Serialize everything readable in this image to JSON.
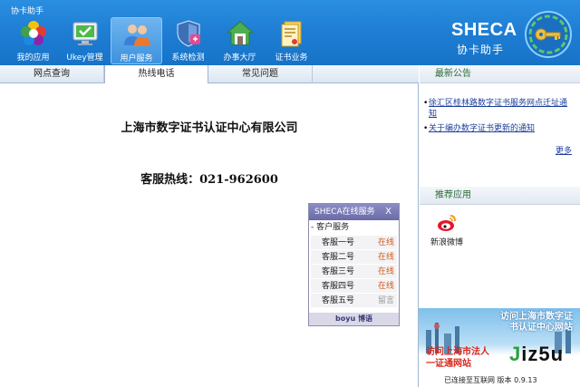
{
  "app": {
    "title": "协卡助手"
  },
  "toolbar": [
    {
      "label": "我的应用",
      "icon": "my-apps-icon",
      "active": false
    },
    {
      "label": "Ukey管理",
      "icon": "ukey-monitor-icon",
      "active": false
    },
    {
      "label": "用户服务",
      "icon": "user-service-icon",
      "active": true
    },
    {
      "label": "系统检测",
      "icon": "system-check-icon",
      "active": false
    },
    {
      "label": "办事大厅",
      "icon": "service-hall-icon",
      "active": false
    },
    {
      "label": "证书业务",
      "icon": "certificate-business-icon",
      "active": false
    }
  ],
  "brand": {
    "name": "SHECA",
    "subtitle": "协卡助手",
    "icon": "sheca-key-logo-icon"
  },
  "tabs": [
    {
      "label": "网点查询",
      "active": false
    },
    {
      "label": "热线电话",
      "active": true
    },
    {
      "label": "常见问题",
      "active": false
    }
  ],
  "main": {
    "company": "上海市数字证书认证中心有限公司",
    "hotline": "客服热线：021-962600"
  },
  "service_widget": {
    "title": "SHECA在线服务",
    "close": "X",
    "group": "客户服务",
    "group_prefix": "-",
    "agents": [
      {
        "name": "客服一号",
        "status": "在线"
      },
      {
        "name": "客服二号",
        "status": "在线"
      },
      {
        "name": "客服三号",
        "status": "在线"
      },
      {
        "name": "客服四号",
        "status": "在线"
      },
      {
        "name": "客服五号",
        "status": "留言"
      }
    ],
    "footer": "boyu 博语"
  },
  "sidebar": {
    "news_title": "最新公告",
    "news": [
      {
        "text": "徐汇区桂林路数字证书服务网点迁址通知"
      },
      {
        "text": "关于编办数字证书更新的通知"
      }
    ],
    "more": "更多",
    "recommend_title": "推荐应用",
    "apps": [
      {
        "label": "新浪微博",
        "icon": "weibo-icon"
      }
    ]
  },
  "banner": {
    "line1a": "访问上海市数字证",
    "line1b": "书认证中心网站",
    "line2a": "访问上海市法人",
    "line2b": "一证通网站",
    "watermark_j": "J",
    "watermark_rest": "iz5u"
  },
  "status": {
    "text": "已连接至互联网 版本 0.9.13"
  },
  "colors": {
    "header": "#1f7fd4",
    "accent_green": "#2a6a35",
    "online": "#d05a1a",
    "link": "#1c3f9c"
  }
}
